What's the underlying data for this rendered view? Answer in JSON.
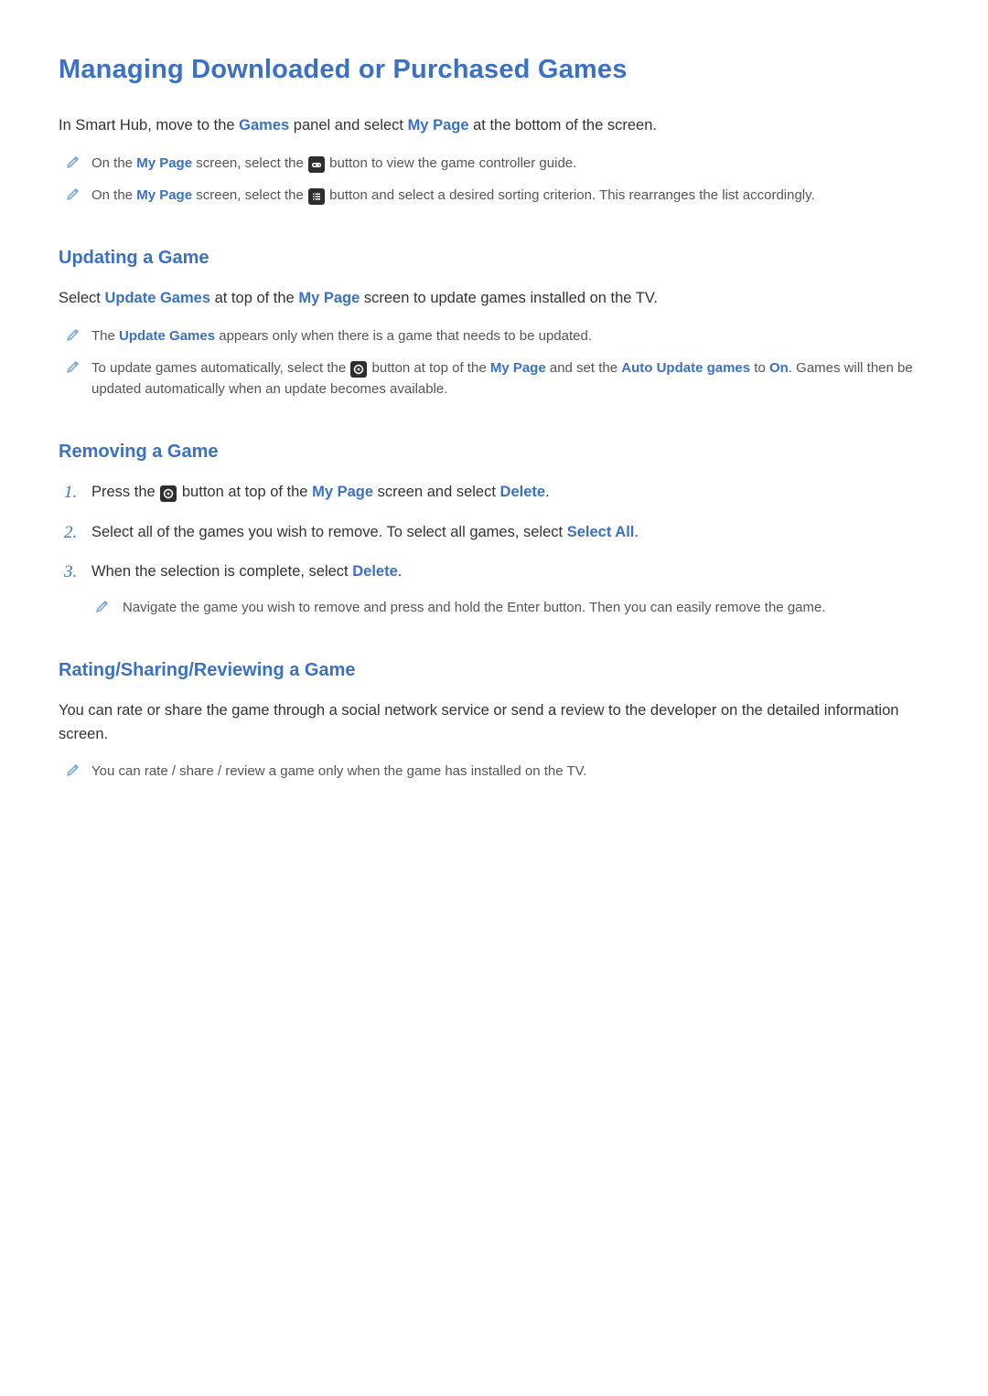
{
  "title": "Managing Downloaded or Purchased Games",
  "intro": {
    "pre": "In Smart Hub, move to the ",
    "hl1": "Games",
    "mid": " panel and select ",
    "hl2": "My Page",
    "post": " at the bottom of the screen."
  },
  "intro_notes": [
    {
      "pre": "On the ",
      "hl1": "My Page",
      "mid1": " screen, select the ",
      "icon": "controller",
      "post": " button to view the game controller guide."
    },
    {
      "pre": "On the ",
      "hl1": "My Page",
      "mid1": " screen, select the ",
      "icon": "list",
      "post": " button and select a desired sorting criterion. This rearranges the list accordingly."
    }
  ],
  "sections": {
    "updating": {
      "heading": "Updating a Game",
      "lead": {
        "pre": "Select ",
        "hl1": "Update Games",
        "mid": " at top of the ",
        "hl2": "My Page",
        "post": " screen to update games installed on the TV."
      },
      "notes": [
        {
          "pre": "The ",
          "hl1": "Update Games",
          "post": " appears only when there is a game that needs to be updated."
        },
        {
          "pre": "To update games automatically, select the ",
          "icon": "gear",
          "mid1": " button at top of the ",
          "hl1": "My Page",
          "mid2": " and set the ",
          "hl2": "Auto Update games",
          "mid3": " to ",
          "hl3": "On",
          "post": ". Games will then be updated automatically when an update becomes available."
        }
      ]
    },
    "removing": {
      "heading": "Removing a Game",
      "steps": [
        {
          "pre": "Press the ",
          "icon": "gear",
          "mid1": " button at top of the ",
          "hl1": "My Page",
          "mid2": " screen and select ",
          "hl2": "Delete",
          "post": "."
        },
        {
          "pre": "Select all of the games you wish to remove. To select all games, select ",
          "hl1": "Select All",
          "post": "."
        },
        {
          "pre": "When the selection is complete, select ",
          "hl1": "Delete",
          "post": "."
        }
      ],
      "step3_note": "Navigate the game you wish to remove and press and hold the Enter button. Then you can easily remove the game."
    },
    "rating": {
      "heading": "Rating/Sharing/Reviewing a Game",
      "lead": "You can rate or share the game through a social network service or send a review to the developer on the detailed information screen.",
      "note": "You can rate / share / review a game only when the game has installed on the TV."
    }
  }
}
